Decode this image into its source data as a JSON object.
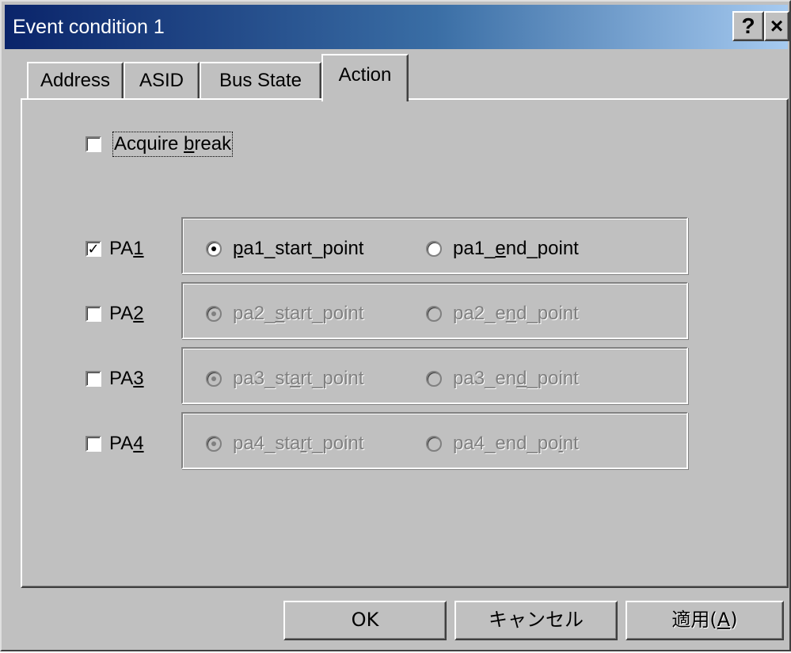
{
  "window": {
    "title": "Event condition 1",
    "help_label": "?",
    "close_label": "×"
  },
  "tabs": [
    {
      "label": "Address"
    },
    {
      "label": "ASID"
    },
    {
      "label": "Bus State"
    },
    {
      "label": "Action",
      "active": true
    }
  ],
  "acquire_break": {
    "pre": "Acquire ",
    "accel": "b",
    "post": "reak",
    "checked": false
  },
  "rows": [
    {
      "pa_label_pre": "PA",
      "pa_label_accel": "1",
      "checked": true,
      "start_pre": "",
      "start_accel": "p",
      "start_post": "a1_start_point",
      "start_selected": true,
      "end_pre": "pa1_",
      "end_accel": "e",
      "end_post": "nd_point",
      "end_selected": false,
      "enabled": true
    },
    {
      "pa_label_pre": "PA",
      "pa_label_accel": "2",
      "checked": false,
      "start_pre": "pa2_",
      "start_accel": "s",
      "start_post": "tart_point",
      "start_selected": true,
      "end_pre": "pa2_e",
      "end_accel": "n",
      "end_post": "d_point",
      "end_selected": false,
      "enabled": false
    },
    {
      "pa_label_pre": "PA",
      "pa_label_accel": "3",
      "checked": false,
      "start_pre": "pa3_st",
      "start_accel": "a",
      "start_post": "rt_point",
      "start_selected": true,
      "end_pre": "pa3_en",
      "end_accel": "d",
      "end_post": "_point",
      "end_selected": false,
      "enabled": false
    },
    {
      "pa_label_pre": "PA",
      "pa_label_accel": "4",
      "checked": false,
      "start_pre": "pa4_sta",
      "start_accel": "r",
      "start_post": "t_point",
      "start_selected": true,
      "end_pre": "pa4_end_po",
      "end_accel": "i",
      "end_post": "nt",
      "end_selected": false,
      "enabled": false
    }
  ],
  "buttons": {
    "ok": "OK",
    "cancel": "キャンセル",
    "apply_pre": "適用(",
    "apply_accel": "A",
    "apply_post": ")"
  },
  "icons": {
    "help": "help-icon",
    "close": "close-icon",
    "check": "checkmark-icon"
  }
}
